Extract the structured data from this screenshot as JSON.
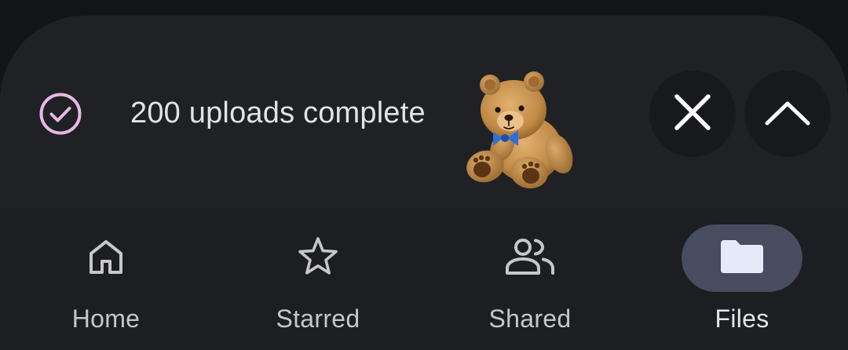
{
  "upload_banner": {
    "status_text": "200 uploads complete",
    "status_icon": "check-circle-icon",
    "sticker": "teddy-bear-sticker",
    "close_icon": "close-icon",
    "expand_icon": "chevron-up-icon",
    "check_color": "#e7b8e6"
  },
  "bottom_nav": {
    "items": [
      {
        "label": "Home",
        "icon": "home-icon",
        "active": false
      },
      {
        "label": "Starred",
        "icon": "star-icon",
        "active": false
      },
      {
        "label": "Shared",
        "icon": "people-icon",
        "active": false
      },
      {
        "label": "Files",
        "icon": "folder-icon",
        "active": true
      }
    ],
    "active_pill_color": "#474c5e"
  }
}
